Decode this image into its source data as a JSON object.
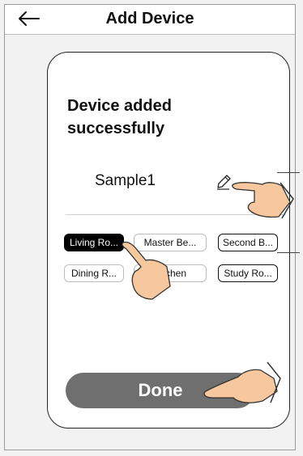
{
  "header": {
    "title": "Add Device",
    "back_icon": "arrow-left-icon"
  },
  "card": {
    "headline": "Device added successfully",
    "device_name": "Sample1",
    "edit_icon": "pencil-icon"
  },
  "rooms": [
    {
      "label": "Living Ro...",
      "selected": true
    },
    {
      "label": "Master Be...",
      "selected": false
    },
    {
      "label": "Second B...",
      "selected": false
    },
    {
      "label": "Dining R...",
      "selected": false
    },
    {
      "label": "Kitchen",
      "selected": false
    },
    {
      "label": "Study Ro...",
      "selected": false
    }
  ],
  "done_label": "Done",
  "colors": {
    "selected_room": "#000000",
    "done_button": "#6f6f6f"
  }
}
